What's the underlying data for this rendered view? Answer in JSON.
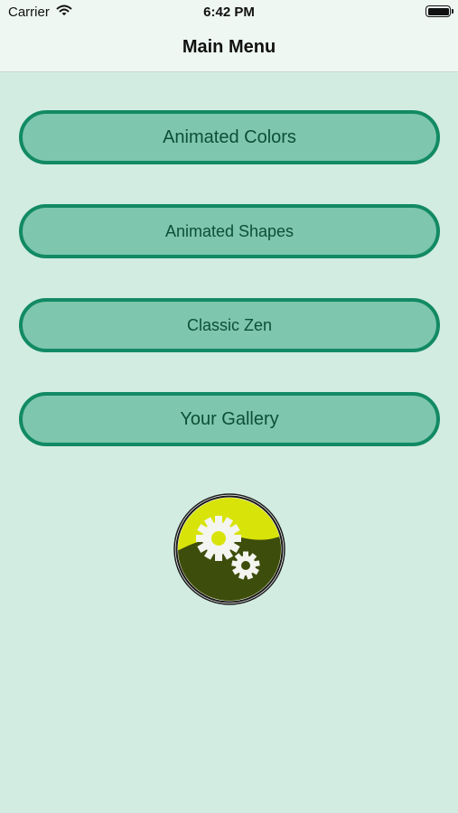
{
  "status_bar": {
    "carrier": "Carrier",
    "time": "6:42 PM",
    "wifi_icon": "wifi-icon",
    "battery_icon": "battery-icon"
  },
  "nav": {
    "title": "Main Menu"
  },
  "menu": [
    {
      "label": "Animated Colors"
    },
    {
      "label": "Animated Shapes"
    },
    {
      "label": "Classic Zen"
    },
    {
      "label": "Your Gallery"
    }
  ],
  "settings_button": {
    "icon": "gears-icon"
  },
  "colors": {
    "background": "#d2ece1",
    "button_fill": "#7ec6ae",
    "button_border": "#128a64",
    "button_text": "#0d4e36",
    "icon_yellow": "#d8e30a",
    "icon_dark": "#3d4d0c"
  }
}
